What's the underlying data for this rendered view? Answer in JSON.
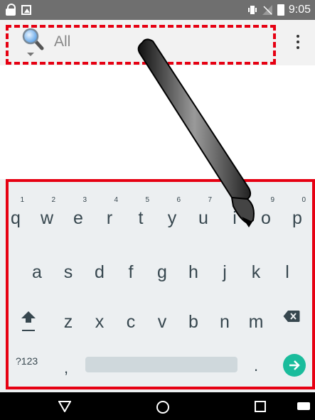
{
  "status_bar": {
    "time": "9:05",
    "left_icons": [
      "lock-icon",
      "photo-icon"
    ],
    "right_icons": [
      "vibrate-icon",
      "no-signal-icon",
      "battery-icon"
    ]
  },
  "search": {
    "placeholder": "All",
    "icon": "search-icon",
    "menu_icon": "overflow-menu-icon"
  },
  "keyboard": {
    "row1": [
      {
        "key": "q",
        "hint": "1"
      },
      {
        "key": "w",
        "hint": "2"
      },
      {
        "key": "e",
        "hint": "3"
      },
      {
        "key": "r",
        "hint": "4"
      },
      {
        "key": "t",
        "hint": "5"
      },
      {
        "key": "y",
        "hint": "6"
      },
      {
        "key": "u",
        "hint": "7"
      },
      {
        "key": "i",
        "hint": "8"
      },
      {
        "key": "o",
        "hint": "9"
      },
      {
        "key": "p",
        "hint": "0"
      }
    ],
    "row2": [
      "a",
      "s",
      "d",
      "f",
      "g",
      "h",
      "j",
      "k",
      "l"
    ],
    "row3": [
      "z",
      "x",
      "c",
      "v",
      "b",
      "n",
      "m"
    ],
    "symbols_label": "?123",
    "comma": ",",
    "period": ".",
    "colors": {
      "background": "#eceff1",
      "enter": "#1abc9c",
      "key_text": "#37474f"
    }
  },
  "nav_bar": {
    "icons": [
      "back-icon",
      "home-icon",
      "recents-icon",
      "keyboard-switch-icon"
    ]
  },
  "annotations": {
    "highlight_color": "#e60012"
  }
}
